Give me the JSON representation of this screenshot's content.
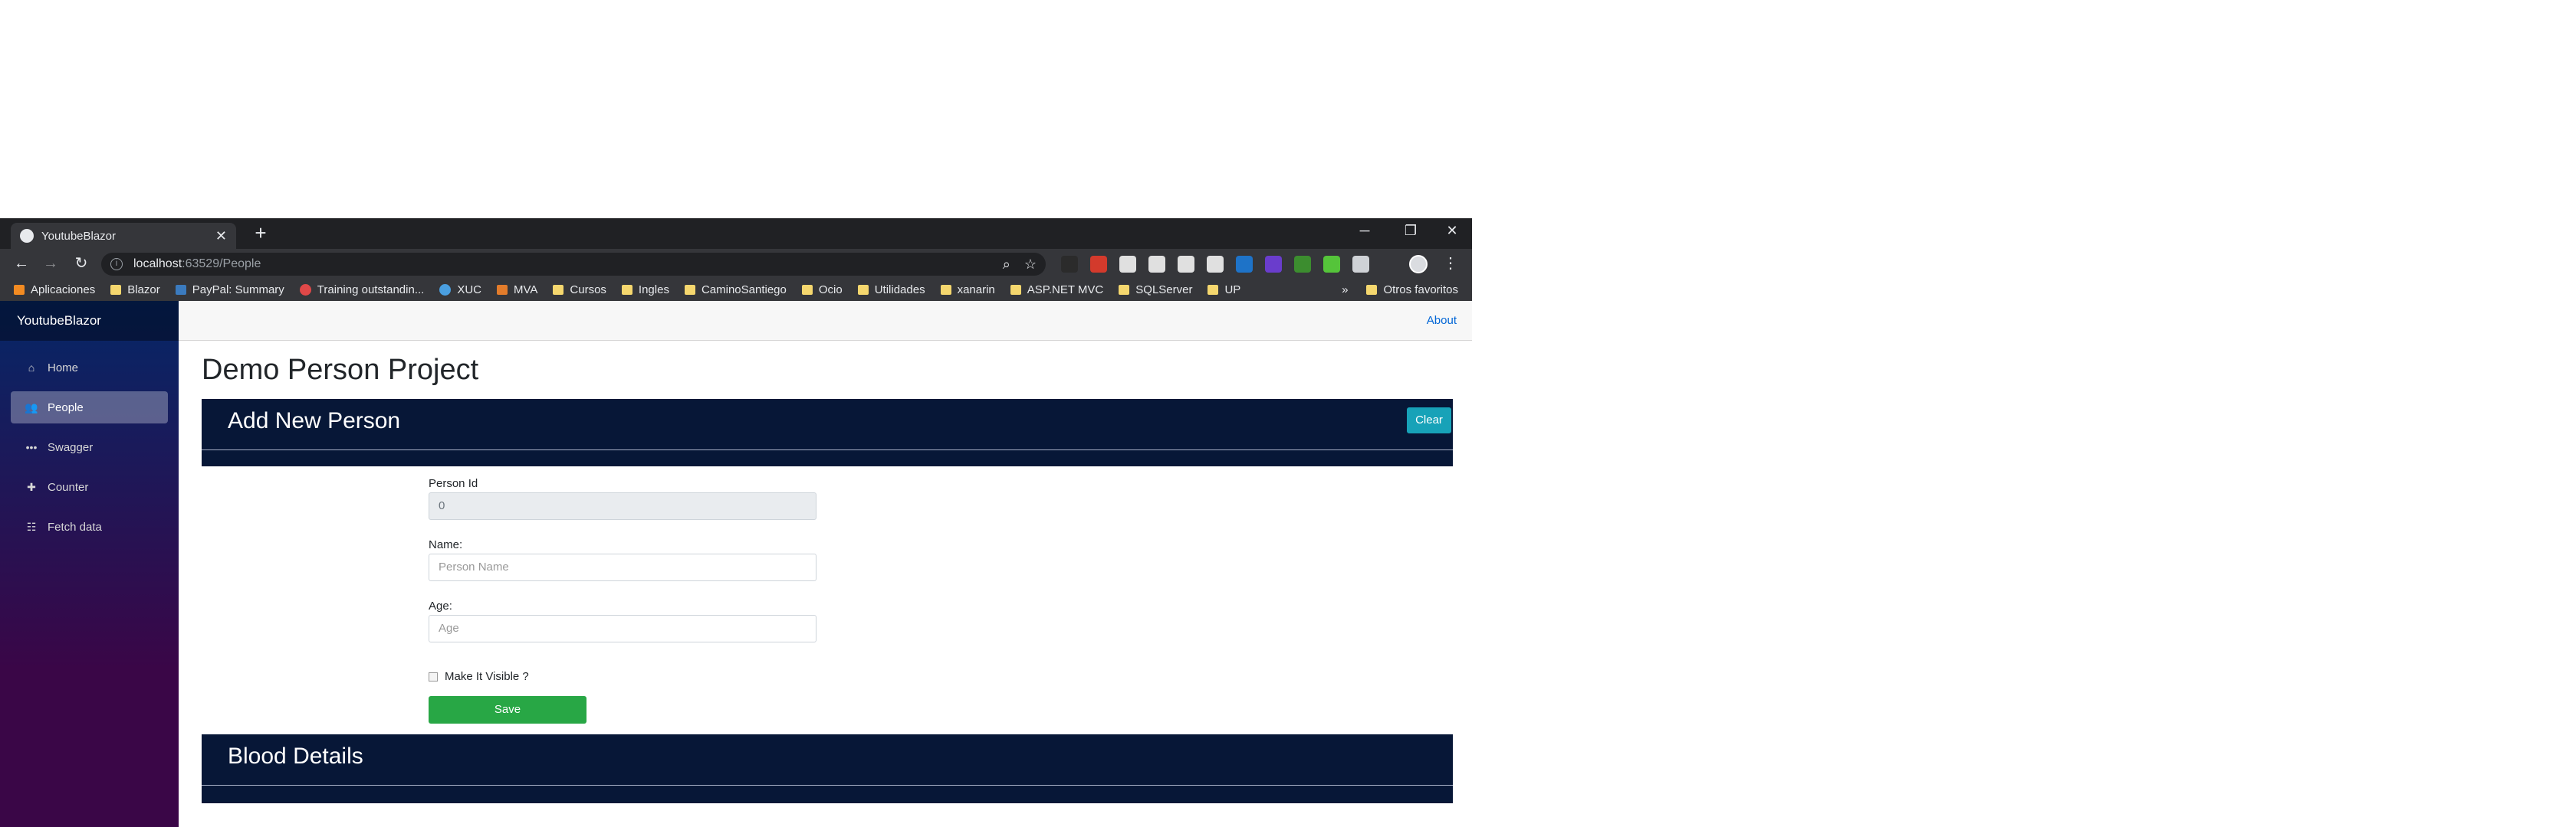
{
  "browser": {
    "tab_title": "YoutubeBlazor",
    "tab_close": "✕",
    "new_tab": "+",
    "window_controls": {
      "minimize": "─",
      "restore": "❐",
      "close": "✕"
    },
    "nav": {
      "back": "←",
      "forward": "→",
      "reload": "↻"
    },
    "url_host": "localhost",
    "url_path": ":63529/People",
    "bookmarks": [
      "Aplicaciones",
      "Blazor",
      "PayPal: Summary",
      "Training outstandin...",
      "XUC",
      "MVA",
      "Cursos",
      "Ingles",
      "CaminoSantiego",
      "Ocio",
      "Utilidades",
      "xanarin",
      "ASP.NET MVC",
      "SQLServer",
      "UP"
    ],
    "bookmarks_more": "»",
    "other_bookmarks": "Otros favoritos",
    "extension_colors": [
      "#2b2b2b",
      "#d33a2c",
      "#e0e0e0",
      "#e0e0e0",
      "#e0e0e0",
      "#e0e0e0",
      "#1e73c8",
      "#6a3dcc",
      "#3c8d2f",
      "#55c43a",
      "#cfd2d6"
    ]
  },
  "app": {
    "brand": "YoutubeBlazor",
    "about": "About",
    "nav_items": [
      {
        "label": "Home",
        "icon": "home-icon",
        "active": false
      },
      {
        "label": "People",
        "icon": "people-icon",
        "active": true
      },
      {
        "label": "Swagger",
        "icon": "ellipsis-icon",
        "active": false
      },
      {
        "label": "Counter",
        "icon": "plus-icon",
        "active": false
      },
      {
        "label": "Fetch data",
        "icon": "list-icon",
        "active": false
      }
    ],
    "page_title": "Demo Person Project",
    "add_panel": {
      "title": "Add New Person",
      "clear_label": "Clear"
    },
    "form": {
      "person_id_label": "Person Id",
      "person_id_value": "0",
      "name_label": "Name:",
      "name_placeholder": "Person Name",
      "age_label": "Age:",
      "age_placeholder": "Age",
      "visible_label": "Make It Visible ?",
      "save_label": "Save"
    },
    "blood_panel": {
      "title": "Blood Details"
    }
  }
}
